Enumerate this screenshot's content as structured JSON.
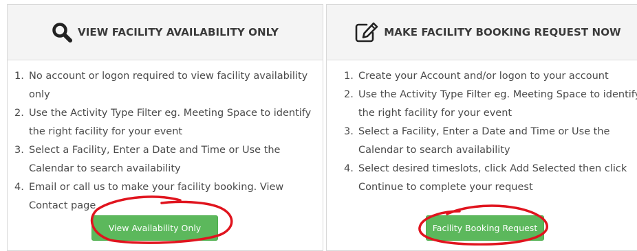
{
  "availability_panel": {
    "icon": "search-icon",
    "title": "VIEW FACILITY AVAILABILITY ONLY",
    "steps": [
      {
        "num": "1.",
        "text": "No account or logon required to view facility availability only"
      },
      {
        "num": "2.",
        "text": "Use the Activity Type Filter eg. Meeting Space to identify the right facility for your event"
      },
      {
        "num": "3.",
        "text": "Select a Facility, Enter a Date and Time or Use the Calendar to search availability"
      },
      {
        "num": "4.",
        "text": "Email or call us to make your facility booking. View Contact page"
      }
    ],
    "button_label": "View Availability Only"
  },
  "booking_panel": {
    "icon": "edit-icon",
    "title": "MAKE FACILITY BOOKING REQUEST NOW",
    "steps": [
      {
        "num": "1.",
        "text": "Create your Account and/or logon to your account"
      },
      {
        "num": "2.",
        "text": "Use the Activity Type Filter eg. Meeting Space to identify the right facility for your event"
      },
      {
        "num": "3.",
        "text": "Select a Facility, Enter a Date and Time or Use the Calendar to search availability"
      },
      {
        "num": "4.",
        "text": "Select desired timeslots, click Add Selected then click Continue to complete your request"
      }
    ],
    "button_label": "Facility Booking Request"
  },
  "colors": {
    "button_green": "#5cb85c",
    "header_bg": "#f4f4f4",
    "annotation_red": "#e0141e"
  }
}
